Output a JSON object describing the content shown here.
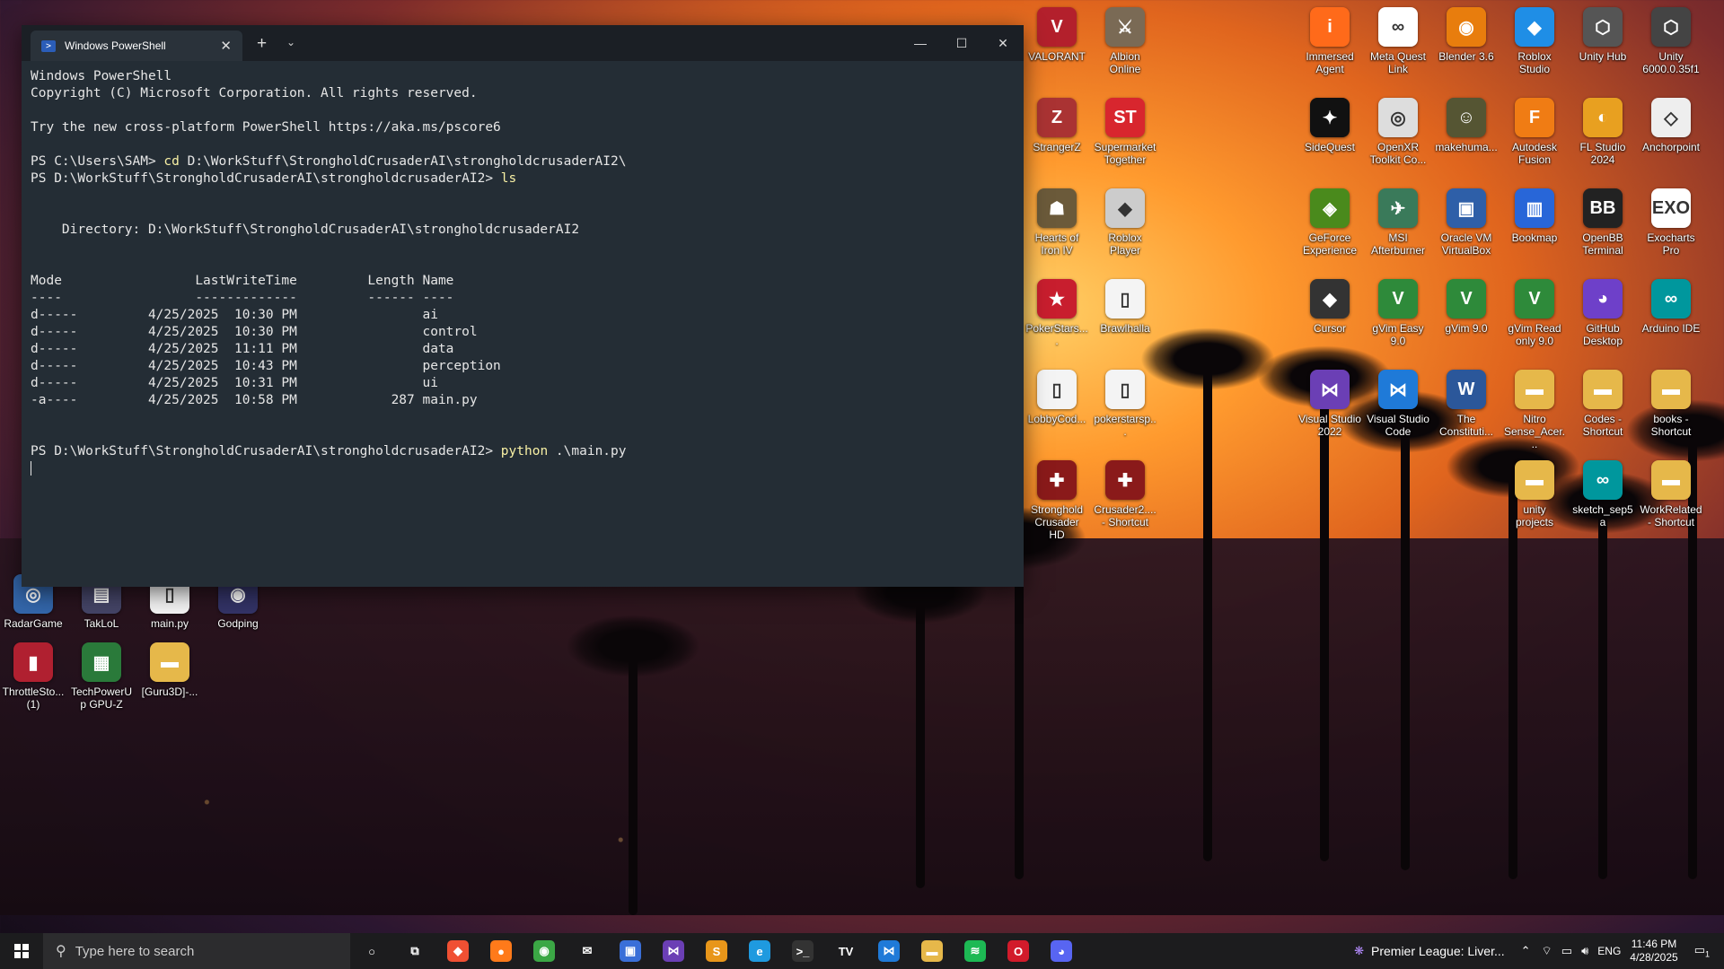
{
  "window": {
    "tab_title": "Windows PowerShell",
    "minimize": "—",
    "maximize": "☐",
    "close": "✕",
    "new_tab": "+",
    "dropdown": "⌄"
  },
  "terminal": {
    "lines": [
      "Windows PowerShell",
      "Copyright (C) Microsoft Corporation. All rights reserved.",
      "",
      "Try the new cross-platform PowerShell https://aka.ms/pscore6",
      "",
      {
        "prompt": "PS C:\\Users\\SAM> ",
        "cmd": "cd",
        "rest": " D:\\WorkStuff\\StrongholdCrusaderAI\\strongholdcrusaderAI2\\"
      },
      {
        "prompt": "PS D:\\WorkStuff\\StrongholdCrusaderAI\\strongholdcrusaderAI2> ",
        "cmd": "ls",
        "rest": ""
      },
      "",
      "",
      "    Directory: D:\\WorkStuff\\StrongholdCrusaderAI\\strongholdcrusaderAI2",
      "",
      "",
      "Mode                 LastWriteTime         Length Name",
      "----                 -------------         ------ ----",
      "d-----         4/25/2025  10:30 PM                ai",
      "d-----         4/25/2025  10:30 PM                control",
      "d-----         4/25/2025  11:11 PM                data",
      "d-----         4/25/2025  10:43 PM                perception",
      "d-----         4/25/2025  10:31 PM                ui",
      "-a----         4/25/2025  10:58 PM            287 main.py",
      "",
      "",
      {
        "prompt": "PS D:\\WorkStuff\\StrongholdCrusaderAI\\strongholdcrusaderAI2> ",
        "cmd": "python",
        "rest": " .\\main.py"
      }
    ]
  },
  "desktop_icons_right": [
    {
      "label": "VALORANT",
      "color": "#b3202c",
      "glyph": "V"
    },
    {
      "label": "Albion Online",
      "color": "#7a6a55",
      "glyph": "⚔"
    },
    {
      "label": "Immersed Agent",
      "color": "#ff6a1a",
      "glyph": "i"
    },
    {
      "label": "Meta Quest Link",
      "color": "#ffffff",
      "glyph": "∞"
    },
    {
      "label": "Blender 3.6",
      "color": "#e87d0d",
      "glyph": "◉"
    },
    {
      "label": "Roblox Studio",
      "color": "#1f8ee6",
      "glyph": "◆"
    },
    {
      "label": "Unity Hub",
      "color": "#555555",
      "glyph": "⬡"
    },
    {
      "label": "Unity 6000.0.35f1",
      "color": "#444444",
      "glyph": "⬡"
    },
    {
      "label": "StrangerZ",
      "color": "#a33",
      "glyph": "Z"
    },
    {
      "label": "Supermarket Together",
      "color": "#d8262e",
      "glyph": "ST"
    },
    {
      "label": "SideQuest",
      "color": "#111111",
      "glyph": "✦"
    },
    {
      "label": "OpenXR Toolkit Co...",
      "color": "#ddd",
      "glyph": "◎"
    },
    {
      "label": "makehuma...",
      "color": "#553",
      "glyph": "☺"
    },
    {
      "label": "Autodesk Fusion",
      "color": "#f07c14",
      "glyph": "F"
    },
    {
      "label": "FL Studio 2024",
      "color": "#e8a020",
      "glyph": "◐"
    },
    {
      "label": "Anchorpoint",
      "color": "#eee",
      "glyph": "◇"
    },
    {
      "label": "Hearts of Iron IV",
      "color": "#6b5a3a",
      "glyph": "☗"
    },
    {
      "label": "Roblox Player",
      "color": "#cccccc",
      "glyph": "◆"
    },
    {
      "label": "GeForce Experience",
      "color": "#4a8a1c",
      "glyph": "◈"
    },
    {
      "label": "MSI Afterburner",
      "color": "#3a7a5a",
      "glyph": "✈"
    },
    {
      "label": "Oracle VM VirtualBox",
      "color": "#2e5fa8",
      "glyph": "▣"
    },
    {
      "label": "Bookmap",
      "color": "#2866d8",
      "glyph": "▥"
    },
    {
      "label": "OpenBB Terminal",
      "color": "#222222",
      "glyph": "BB"
    },
    {
      "label": "Exocharts Pro",
      "color": "#ffffff",
      "glyph": "EXO"
    },
    {
      "label": "PokerStars....",
      "color": "#c81e2e",
      "glyph": "★"
    },
    {
      "label": "Brawlhalla",
      "color": "#f4f4f4",
      "glyph": "▯"
    },
    {
      "label": "Cursor",
      "color": "#333",
      "glyph": "◆"
    },
    {
      "label": "gVim Easy 9.0",
      "color": "#2e8a3a",
      "glyph": "V"
    },
    {
      "label": "gVim 9.0",
      "color": "#2e8a3a",
      "glyph": "V"
    },
    {
      "label": "gVim Read only 9.0",
      "color": "#2e8a3a",
      "glyph": "V"
    },
    {
      "label": "GitHub Desktop",
      "color": "#6e40c9",
      "glyph": "◕"
    },
    {
      "label": "Arduino IDE",
      "color": "#00979d",
      "glyph": "∞"
    },
    {
      "label": "LobbyCod...",
      "color": "#f4f4f4",
      "glyph": "▯"
    },
    {
      "label": "pokerstarsp...",
      "color": "#f4f4f4",
      "glyph": "▯"
    },
    {
      "label": "Visual Studio 2022",
      "color": "#6b3fb5",
      "glyph": "⋈"
    },
    {
      "label": "Visual Studio Code",
      "color": "#1f7ad8",
      "glyph": "⋈"
    },
    {
      "label": "The Constituti...",
      "color": "#2b579a",
      "glyph": "W"
    },
    {
      "label": "Nitro Sense_Acer...",
      "color": "#e6b84a",
      "glyph": "▬"
    },
    {
      "label": "Codes - Shortcut",
      "color": "#e6b84a",
      "glyph": "▬"
    },
    {
      "label": "books - Shortcut",
      "color": "#e6b84a",
      "glyph": "▬"
    },
    {
      "label": "Stronghold Crusader HD",
      "color": "#8a1a1a",
      "glyph": "✚"
    },
    {
      "label": "Crusader2.... - Shortcut",
      "color": "#8a1a1a",
      "glyph": "✚"
    },
    {
      "label": "unity projects",
      "color": "#e6b84a",
      "glyph": "▬"
    },
    {
      "label": "sketch_sep5a",
      "color": "#00979d",
      "glyph": "∞"
    },
    {
      "label": "WorkRelated - Shortcut",
      "color": "#e6b84a",
      "glyph": "▬"
    }
  ],
  "desktop_icons_left": [
    {
      "label": "RadarGame",
      "color": "#3366aa",
      "glyph": "◎"
    },
    {
      "label": "TakLoL",
      "color": "#446",
      "glyph": "▤"
    },
    {
      "label": "main.py",
      "color": "#f4f4f4",
      "glyph": "▯"
    },
    {
      "label": "Godping",
      "color": "#336",
      "glyph": "◉"
    },
    {
      "label": "ThrottleSto... (1)",
      "color": "#b02030",
      "glyph": "▮"
    },
    {
      "label": "TechPowerUp GPU-Z",
      "color": "#2a7a3a",
      "glyph": "▦"
    },
    {
      "label": "[Guru3D]-...",
      "color": "#e6b84a",
      "glyph": "▬"
    }
  ],
  "taskbar": {
    "search_placeholder": "Type here to search",
    "apps": [
      {
        "name": "cortana-icon",
        "glyph": "○",
        "color": "transparent"
      },
      {
        "name": "task-view-icon",
        "glyph": "⧉",
        "color": "transparent"
      },
      {
        "name": "git-icon",
        "glyph": "◆",
        "color": "#f05033"
      },
      {
        "name": "firefox-icon",
        "glyph": "●",
        "color": "#ff7a1a"
      },
      {
        "name": "chrome-icon",
        "glyph": "◉",
        "color": "#3ba745"
      },
      {
        "name": "mail-icon",
        "glyph": "✉",
        "color": "transparent"
      },
      {
        "name": "store-icon",
        "glyph": "▣",
        "color": "#3a6fd8"
      },
      {
        "name": "visual-studio-icon",
        "glyph": "⋈",
        "color": "#6b3fb5"
      },
      {
        "name": "sublime-icon",
        "glyph": "S",
        "color": "#e8961a"
      },
      {
        "name": "edge-icon",
        "glyph": "e",
        "color": "#1f9adf"
      },
      {
        "name": "terminal-icon",
        "glyph": ">_",
        "color": "#333"
      },
      {
        "name": "tradingview-icon",
        "glyph": "TV",
        "color": "transparent"
      },
      {
        "name": "vscode-icon",
        "glyph": "⋈",
        "color": "#1f7ad8"
      },
      {
        "name": "file-explorer-icon",
        "glyph": "▬",
        "color": "#e6b84a"
      },
      {
        "name": "spotify-icon",
        "glyph": "≋",
        "color": "#1db954"
      },
      {
        "name": "opera-icon",
        "glyph": "O",
        "color": "#d21b2b"
      },
      {
        "name": "discord-icon",
        "glyph": "◕",
        "color": "#5865f2"
      }
    ],
    "news": "Premier League: Liver...",
    "language": "ENG",
    "time": "11:46 PM",
    "date": "4/28/2025",
    "notifications": "1"
  }
}
